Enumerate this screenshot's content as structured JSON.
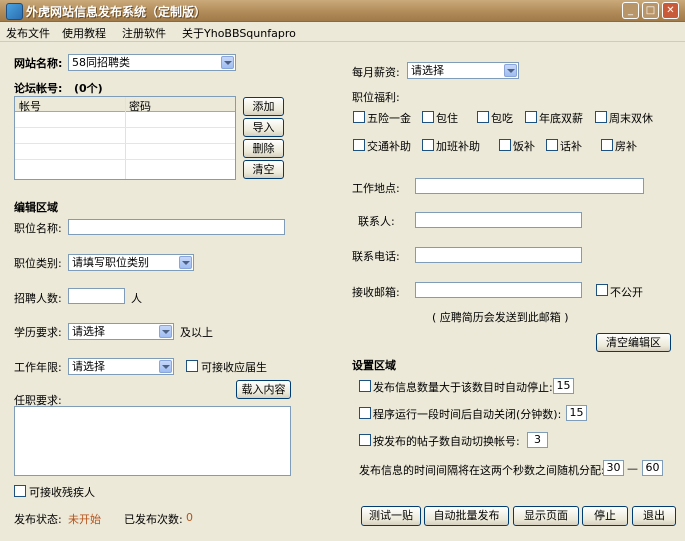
{
  "window": {
    "title": "外虎网站信息发布系统（定制版）"
  },
  "menu": [
    "发布文件",
    "使用教程",
    "注册软件",
    "关于YhoBBSqunfapro"
  ],
  "site": {
    "label": "网站名称:",
    "value": "58同招聘类"
  },
  "accounts": {
    "label": "论坛帐号:",
    "count": "(0个)",
    "columns": [
      "帐号",
      "密码"
    ],
    "buttons": {
      "add": "添加",
      "import": "导入",
      "delete": "删除",
      "clear": "清空"
    }
  },
  "edit": {
    "section": "编辑区域",
    "job_name_label": "职位名称:",
    "job_type_label": "职位类别:",
    "job_type_value": "请填写职位类别",
    "headcount_label": "招聘人数:",
    "headcount_unit": "人",
    "education_label": "学历要求:",
    "education_value": "请选择",
    "education_suffix": "及以上",
    "years_label": "工作年限:",
    "years_value": "请选择",
    "fresh_grad_label": "可接收应届生",
    "load_button": "载入内容",
    "requirement_label": "任职要求:",
    "disabled_label": "可接收残疾人",
    "salary_label": "每月薪资:",
    "salary_value": "请选择",
    "benefits_label": "职位福利:",
    "benefits_row1": [
      "五险一金",
      "包住",
      "包吃",
      "年底双薪",
      "周末双休"
    ],
    "benefits_row2": [
      "交通补助",
      "加班补助",
      "饭补",
      "话补",
      "房补"
    ],
    "location_label": "工作地点:",
    "contact_label": "联系人:",
    "phone_label": "联系电话:",
    "email_label": "接收邮箱:",
    "email_private": "不公开",
    "email_hint": "( 应聘简历会发送到此邮箱 )",
    "clear_button": "清空编辑区"
  },
  "settings": {
    "section": "设置区域",
    "opt1_label": "发布信息数量大于该数目时自动停止:",
    "opt1_value": "15",
    "opt2_label": "程序运行一段时间后自动关闭(分钟数):",
    "opt2_value": "15",
    "opt3_label": "按发布的帖子数自动切换帐号:",
    "opt3_value": "3",
    "interval_label": "发布信息的时间间隔将在这两个秒数之间随机分配:",
    "interval_min": "30",
    "interval_dash": "—",
    "interval_max": "60"
  },
  "status": {
    "label": "发布状态:",
    "value": "未开始",
    "count_label": "已发布次数:",
    "count_value": "0",
    "value_color": "#b8531a"
  },
  "actions": {
    "test": "测试一贴",
    "batch": "自动批量发布",
    "show": "显示页面",
    "stop": "停止",
    "exit": "退出"
  }
}
